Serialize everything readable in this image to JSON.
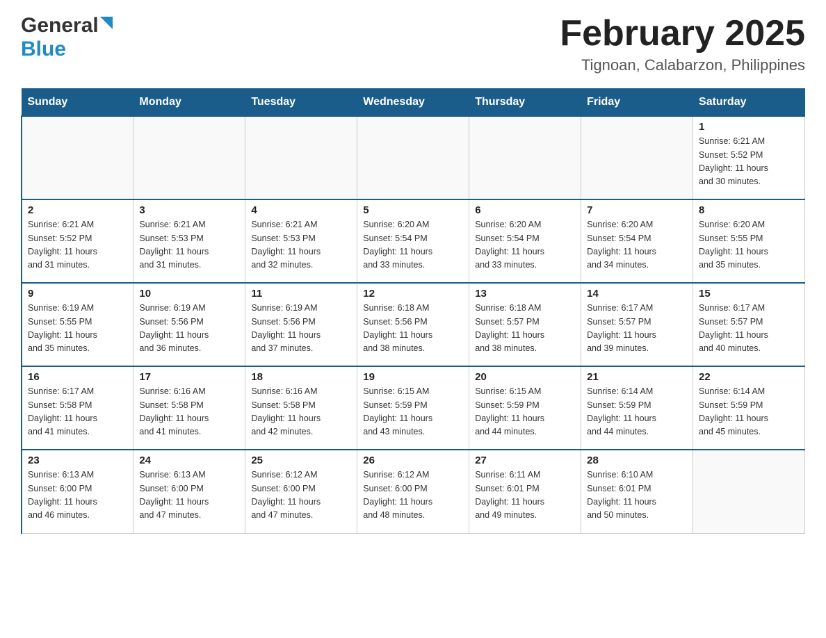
{
  "header": {
    "logo_general": "General",
    "logo_blue": "Blue",
    "month_title": "February 2025",
    "location": "Tignoan, Calabarzon, Philippines"
  },
  "weekdays": [
    "Sunday",
    "Monday",
    "Tuesday",
    "Wednesday",
    "Thursday",
    "Friday",
    "Saturday"
  ],
  "weeks": [
    [
      {
        "day": "",
        "info": ""
      },
      {
        "day": "",
        "info": ""
      },
      {
        "day": "",
        "info": ""
      },
      {
        "day": "",
        "info": ""
      },
      {
        "day": "",
        "info": ""
      },
      {
        "day": "",
        "info": ""
      },
      {
        "day": "1",
        "info": "Sunrise: 6:21 AM\nSunset: 5:52 PM\nDaylight: 11 hours\nand 30 minutes."
      }
    ],
    [
      {
        "day": "2",
        "info": "Sunrise: 6:21 AM\nSunset: 5:52 PM\nDaylight: 11 hours\nand 31 minutes."
      },
      {
        "day": "3",
        "info": "Sunrise: 6:21 AM\nSunset: 5:53 PM\nDaylight: 11 hours\nand 31 minutes."
      },
      {
        "day": "4",
        "info": "Sunrise: 6:21 AM\nSunset: 5:53 PM\nDaylight: 11 hours\nand 32 minutes."
      },
      {
        "day": "5",
        "info": "Sunrise: 6:20 AM\nSunset: 5:54 PM\nDaylight: 11 hours\nand 33 minutes."
      },
      {
        "day": "6",
        "info": "Sunrise: 6:20 AM\nSunset: 5:54 PM\nDaylight: 11 hours\nand 33 minutes."
      },
      {
        "day": "7",
        "info": "Sunrise: 6:20 AM\nSunset: 5:54 PM\nDaylight: 11 hours\nand 34 minutes."
      },
      {
        "day": "8",
        "info": "Sunrise: 6:20 AM\nSunset: 5:55 PM\nDaylight: 11 hours\nand 35 minutes."
      }
    ],
    [
      {
        "day": "9",
        "info": "Sunrise: 6:19 AM\nSunset: 5:55 PM\nDaylight: 11 hours\nand 35 minutes."
      },
      {
        "day": "10",
        "info": "Sunrise: 6:19 AM\nSunset: 5:56 PM\nDaylight: 11 hours\nand 36 minutes."
      },
      {
        "day": "11",
        "info": "Sunrise: 6:19 AM\nSunset: 5:56 PM\nDaylight: 11 hours\nand 37 minutes."
      },
      {
        "day": "12",
        "info": "Sunrise: 6:18 AM\nSunset: 5:56 PM\nDaylight: 11 hours\nand 38 minutes."
      },
      {
        "day": "13",
        "info": "Sunrise: 6:18 AM\nSunset: 5:57 PM\nDaylight: 11 hours\nand 38 minutes."
      },
      {
        "day": "14",
        "info": "Sunrise: 6:17 AM\nSunset: 5:57 PM\nDaylight: 11 hours\nand 39 minutes."
      },
      {
        "day": "15",
        "info": "Sunrise: 6:17 AM\nSunset: 5:57 PM\nDaylight: 11 hours\nand 40 minutes."
      }
    ],
    [
      {
        "day": "16",
        "info": "Sunrise: 6:17 AM\nSunset: 5:58 PM\nDaylight: 11 hours\nand 41 minutes."
      },
      {
        "day": "17",
        "info": "Sunrise: 6:16 AM\nSunset: 5:58 PM\nDaylight: 11 hours\nand 41 minutes."
      },
      {
        "day": "18",
        "info": "Sunrise: 6:16 AM\nSunset: 5:58 PM\nDaylight: 11 hours\nand 42 minutes."
      },
      {
        "day": "19",
        "info": "Sunrise: 6:15 AM\nSunset: 5:59 PM\nDaylight: 11 hours\nand 43 minutes."
      },
      {
        "day": "20",
        "info": "Sunrise: 6:15 AM\nSunset: 5:59 PM\nDaylight: 11 hours\nand 44 minutes."
      },
      {
        "day": "21",
        "info": "Sunrise: 6:14 AM\nSunset: 5:59 PM\nDaylight: 11 hours\nand 44 minutes."
      },
      {
        "day": "22",
        "info": "Sunrise: 6:14 AM\nSunset: 5:59 PM\nDaylight: 11 hours\nand 45 minutes."
      }
    ],
    [
      {
        "day": "23",
        "info": "Sunrise: 6:13 AM\nSunset: 6:00 PM\nDaylight: 11 hours\nand 46 minutes."
      },
      {
        "day": "24",
        "info": "Sunrise: 6:13 AM\nSunset: 6:00 PM\nDaylight: 11 hours\nand 47 minutes."
      },
      {
        "day": "25",
        "info": "Sunrise: 6:12 AM\nSunset: 6:00 PM\nDaylight: 11 hours\nand 47 minutes."
      },
      {
        "day": "26",
        "info": "Sunrise: 6:12 AM\nSunset: 6:00 PM\nDaylight: 11 hours\nand 48 minutes."
      },
      {
        "day": "27",
        "info": "Sunrise: 6:11 AM\nSunset: 6:01 PM\nDaylight: 11 hours\nand 49 minutes."
      },
      {
        "day": "28",
        "info": "Sunrise: 6:10 AM\nSunset: 6:01 PM\nDaylight: 11 hours\nand 50 minutes."
      },
      {
        "day": "",
        "info": ""
      }
    ]
  ]
}
